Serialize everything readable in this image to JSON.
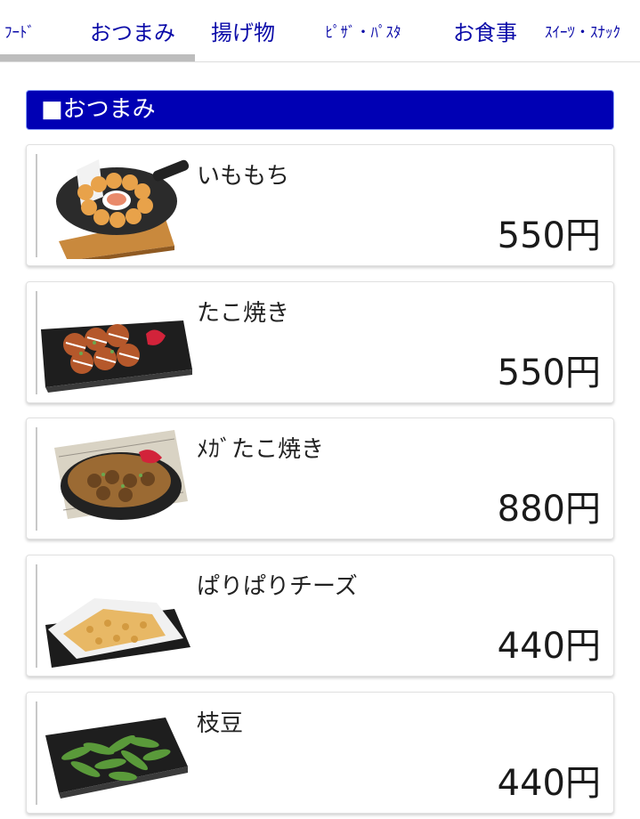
{
  "tabs": [
    {
      "label": "ﾌｰﾄﾞ",
      "active": false
    },
    {
      "label": "おつまみ",
      "active": true
    },
    {
      "label": "揚げ物",
      "active": false
    },
    {
      "label": "ﾋﾟｻﾞ・ﾊﾟｽﾀ",
      "active": false
    },
    {
      "label": "お食事",
      "active": false
    },
    {
      "label": "ｽｲｰﾂ・ｽﾅｯｸ",
      "active": false
    }
  ],
  "section": {
    "title": "■おつまみ"
  },
  "items": [
    {
      "name": "いももち",
      "price": "550円",
      "image": "imomochi-skillet-photo"
    },
    {
      "name": "たこ焼き",
      "price": "550円",
      "image": "takoyaki-plate-photo"
    },
    {
      "name": "ﾒｶﾞたこ焼き",
      "price": "880円",
      "image": "mega-takoyaki-photo"
    },
    {
      "name": "ぱりぱりチーズ",
      "price": "440円",
      "image": "crispy-cheese-photo"
    },
    {
      "name": "枝豆",
      "price": "440円",
      "image": "edamame-plate-photo"
    }
  ],
  "colors": {
    "tab_text": "#0a0aa8",
    "section_bg": "#0000b4",
    "indicator": "#bdbdbd"
  }
}
